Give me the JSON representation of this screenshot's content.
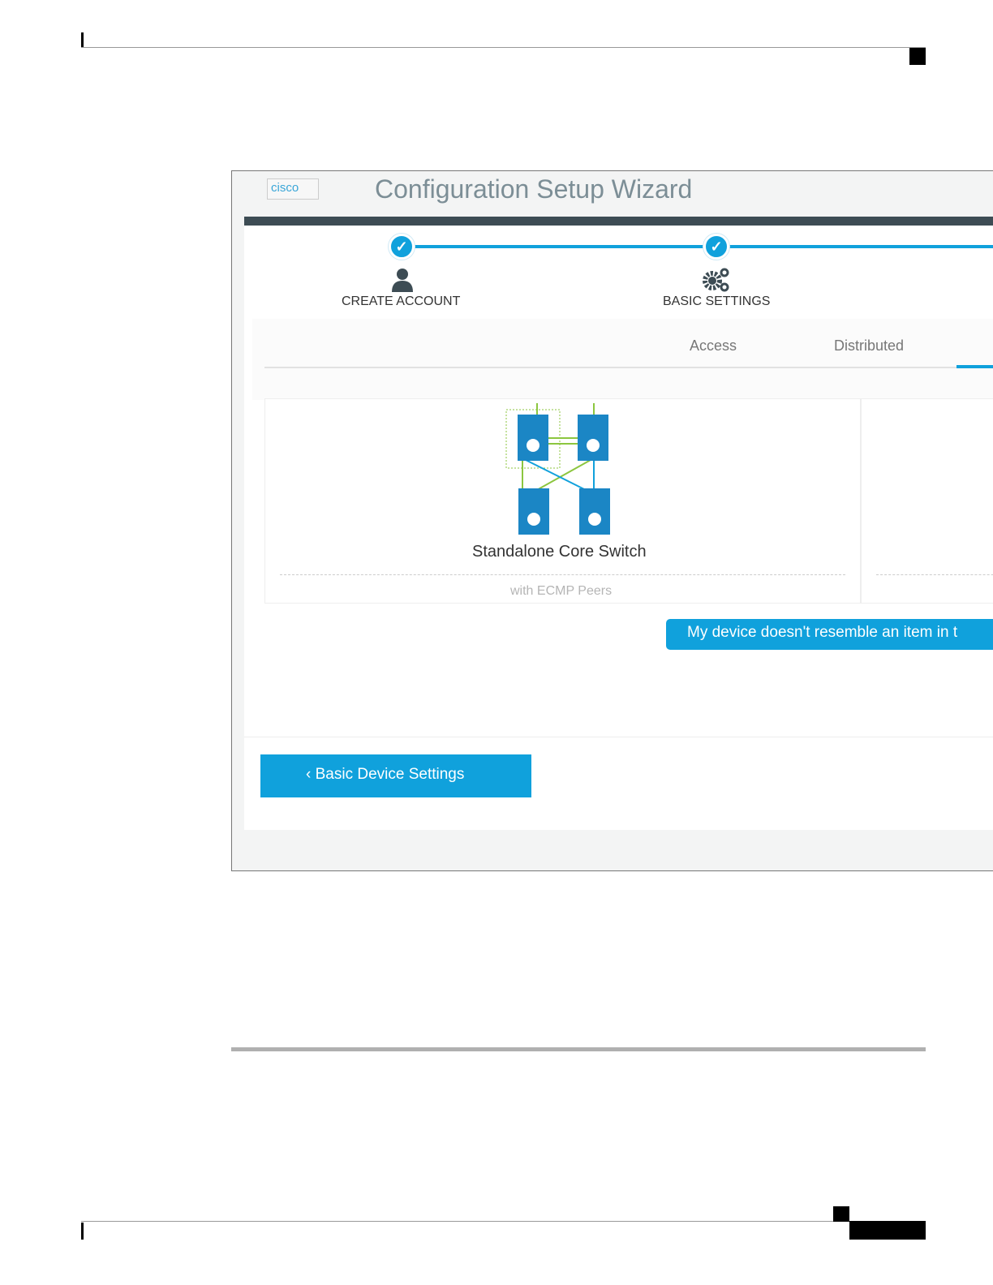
{
  "wizard": {
    "logo_alt": "cisco",
    "title": "Configuration Setup Wizard",
    "steps": [
      {
        "label": "CREATE ACCOUNT",
        "icon": "user-icon",
        "status": "complete"
      },
      {
        "label": "BASIC SETTINGS",
        "icon": "gears-icon",
        "status": "complete"
      }
    ],
    "tabs": [
      {
        "label": "Access"
      },
      {
        "label": "Distributed"
      }
    ],
    "card": {
      "title": "Standalone Core Switch",
      "subtitle": "with ECMP Peers"
    },
    "mismatch_button": "My device doesn't resemble an item in t",
    "back_button": "Basic Device Settings",
    "accent_color": "#10a1dc"
  }
}
